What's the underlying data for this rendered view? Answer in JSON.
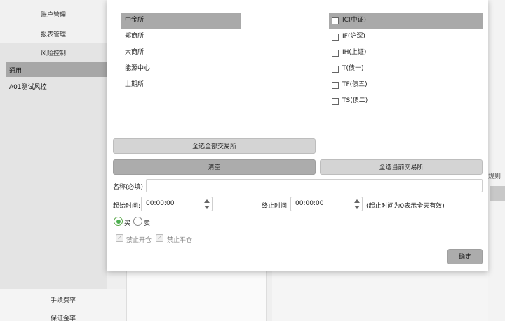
{
  "sidebar": {
    "items": [
      "账户管理",
      "报表管理",
      "风险控制"
    ],
    "sub_items": [
      "通用",
      "A01测试风控"
    ],
    "bottom_items": [
      "手续费率",
      "保证金率"
    ]
  },
  "background": {
    "right_fragment": "规则"
  },
  "exchanges": [
    "中金所",
    "郑商所",
    "大商所",
    "能源中心",
    "上期所"
  ],
  "contracts": [
    "IC(中证)",
    "IF(沪深)",
    "IH(上证)",
    "T(债十)",
    "TF(债五)",
    "TS(债二)"
  ],
  "buttons": {
    "select_all_exchanges": "全选全部交易所",
    "clear": "清空",
    "select_current_exchange": "全选当前交易所",
    "confirm": "确定"
  },
  "form": {
    "name_label": "名称(必填):",
    "name_value": "",
    "start_label": "起始时间:",
    "start_value": "00:00:00",
    "end_label": "终止时间:",
    "end_value": "00:00:00",
    "time_hint": "(起止时间为0表示全天有效)",
    "direction": {
      "buy": "买",
      "sell": "卖",
      "selected": "买"
    },
    "forbid_open": "禁止开仓",
    "forbid_close": "禁止平仓"
  },
  "colors": {
    "selected_row": "#a9a9a9",
    "radio_on": "#4caf50"
  }
}
